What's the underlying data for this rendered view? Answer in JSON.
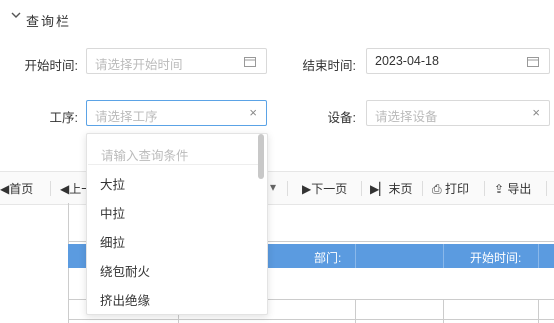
{
  "panel": {
    "title": "查询栏"
  },
  "form": {
    "start_label": "开始时间:",
    "start_placeholder": "请选择开始时间",
    "end_label": "结束时间:",
    "end_value": "2023-04-18",
    "process_label": "工序:",
    "process_placeholder": "请选择工序",
    "device_label": "设备:",
    "device_placeholder": "请选择设备",
    "clear_glyph": "×"
  },
  "dropdown": {
    "search_placeholder": "请输入查询条件",
    "options": [
      "大拉",
      "中拉",
      "细拉",
      "绕包耐火",
      "挤出绝缘"
    ]
  },
  "toolbar": {
    "first": "首页",
    "prev": "上一",
    "next": "下一页",
    "last": "末页",
    "print": "打印",
    "export": "导出"
  },
  "table": {
    "dept_label": "部门:",
    "start_label": "开始时间:"
  },
  "colors": {
    "accent": "#5b9be0",
    "focus_border": "#5ba3e6"
  }
}
